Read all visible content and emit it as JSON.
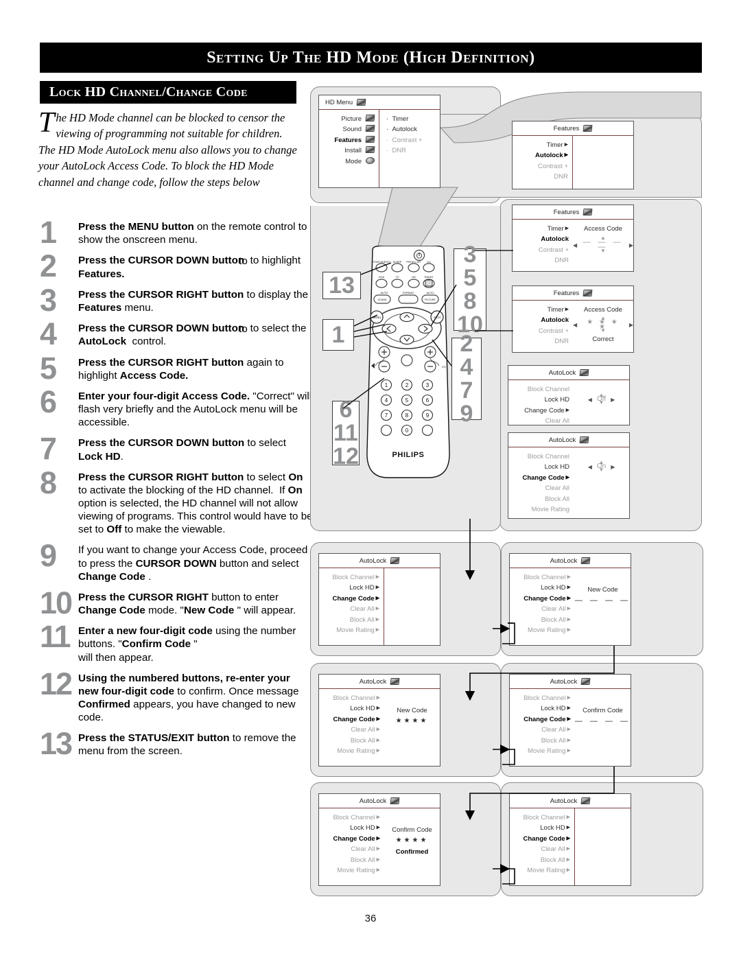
{
  "header": {
    "title": "Setting up the HD Mode (High Definition)",
    "section_title": "Lock HD Channel/Change Code"
  },
  "intro": {
    "dropcap": "T",
    "text": "he HD Mode channel can be blocked to censor the viewing of programming not suitable for children. The HD Mode AutoLock menu also allows you to change your AutoLock Access Code. To block the HD Mode channel and change code, follow the steps below"
  },
  "steps": [
    {
      "num": "1",
      "html": "<b>Press the MENU button</b> on the remote control to show the onscreen menu."
    },
    {
      "num": "2",
      "html": "<b>Press the CURSOR DOWN button</b><span class=\"ovl\"><span class=\"dup\">to</span></span>&nbsp;&nbsp;to highlight <b>Features.</b>"
    },
    {
      "num": "3",
      "html": "<b>Press the CURSOR RIGHT button</b> to display the <b>Features</b> menu."
    },
    {
      "num": "4",
      "html": "<b>Press the CURSOR DOWN button</b><span class=\"ovl\"><span class=\"dup\">to</span></span>&nbsp;&nbsp;to select the <b>AutoLock</b>&nbsp; control."
    },
    {
      "num": "5",
      "html": "<b>Press the CURSOR RIGHT button</b> again to highlight <b>Access Code.</b>"
    },
    {
      "num": "6",
      "html": "<b>Enter your four-digit Access Code.</b> \"Correct\" will flash very briefly and the AutoLock menu will be accessible."
    },
    {
      "num": "7",
      "html": "<b>Press the CURSOR DOWN button</b> to select <b>Lock HD</b>."
    },
    {
      "num": "8",
      "html": "<b>Press the CURSOR RIGHT button</b> to select <b>On</b> to activate the blocking of the HD channel.&nbsp; If <b>On</b> option is selected, the HD channel will not allow viewing of programs. This control would have to be set to <b>Off</b> to make the viewable."
    },
    {
      "num": "9",
      "html": "If you want to change your Access Code, proceed to press the <b>CURSOR DOWN</b> button and select <b>Change Code</b> ."
    },
    {
      "num": "10",
      "html": "<b>Press the CURSOR RIGHT</b> button to enter <b>Change Code</b> mode. \"<b>New Code</b> \" will appear."
    },
    {
      "num": "11",
      "html": "<b>Enter a new four-digit code</b> using the number buttons. \"<b>Confirm Code</b> \"<br>will then appear."
    },
    {
      "num": "12",
      "html": "<b>Using the numbered buttons, re-enter your new four-digit code</b> to confirm. Once message <b>Confirmed</b> appears, you have changed to new code."
    },
    {
      "num": "13",
      "html": "<b>Press the STATUS/EXIT button</b> to remove the menu from the screen."
    }
  ],
  "hd_menu": {
    "title": "HD Menu",
    "left_items": [
      {
        "label": "Picture",
        "state": "normal",
        "icon": "tv-picture-icon"
      },
      {
        "label": "Sound",
        "state": "normal",
        "icon": "speaker-icon"
      },
      {
        "label": "Features",
        "state": "bold",
        "icon": "features-icon"
      },
      {
        "label": "Install",
        "state": "normal",
        "icon": "install-icon"
      },
      {
        "label": "Mode",
        "state": "normal",
        "icon": "mode-icon"
      }
    ],
    "right_items": [
      {
        "label": "Timer",
        "state": "normal"
      },
      {
        "label": "Autolock",
        "state": "normal"
      },
      {
        "label": "Contrast +",
        "state": "dim"
      },
      {
        "label": "DNR",
        "state": "dim"
      }
    ]
  },
  "features_1": {
    "title": "Features",
    "items": [
      {
        "label": "Timer",
        "state": "normal",
        "arrow": true
      },
      {
        "label": "Autolock",
        "state": "bold",
        "arrow": true
      },
      {
        "label": "Contrast +",
        "state": "dim",
        "arrow": false
      },
      {
        "label": "DNR",
        "state": "dim",
        "arrow": false
      }
    ]
  },
  "features_2": {
    "title": "Features",
    "items": [
      {
        "label": "Timer",
        "state": "normal",
        "arrow": true
      },
      {
        "label": "Autolock",
        "state": "bold",
        "arrow": false
      },
      {
        "label": "Contrast +",
        "state": "dim",
        "arrow": false
      },
      {
        "label": "DNR",
        "state": "dim",
        "arrow": false
      }
    ],
    "right_label": "Access Code",
    "value": "— — — —",
    "status": ""
  },
  "features_3": {
    "title": "Features",
    "items": [
      {
        "label": "Timer",
        "state": "normal",
        "arrow": true
      },
      {
        "label": "Autolock",
        "state": "bold",
        "arrow": false
      },
      {
        "label": "Contrast +",
        "state": "dim",
        "arrow": false
      },
      {
        "label": "DNR",
        "state": "dim",
        "arrow": false
      }
    ],
    "right_label": "Access Code",
    "value": "★ ★ ★ ★",
    "status": "Correct"
  },
  "autolock_off": {
    "title": "AutoLock",
    "items": [
      {
        "label": "Block Channel",
        "state": "dim"
      },
      {
        "label": "Lock HD",
        "state": "normal"
      },
      {
        "label": "Change Code",
        "state": "normal",
        "arrow": true
      },
      {
        "label": "Clear All",
        "state": "dim"
      }
    ],
    "value": "Off"
  },
  "autolock_on": {
    "title": "AutoLock",
    "items": [
      {
        "label": "Block Channel",
        "state": "dim"
      },
      {
        "label": "Lock HD",
        "state": "normal"
      },
      {
        "label": "Change Code",
        "state": "bold",
        "arrow": true
      },
      {
        "label": "Clear All",
        "state": "dim"
      },
      {
        "label": "Block All",
        "state": "dim"
      },
      {
        "label": "Movie Rating",
        "state": "dim"
      }
    ],
    "value": "On"
  },
  "autolock_menu_a": {
    "title": "AutoLock",
    "items": [
      {
        "label": "Block Channel",
        "state": "dim",
        "arrow": true
      },
      {
        "label": "Lock HD",
        "state": "normal",
        "arrow": true
      },
      {
        "label": "Change Code",
        "state": "bold",
        "arrow": true
      },
      {
        "label": "Clear All",
        "state": "dim",
        "arrow": true
      },
      {
        "label": "Block All",
        "state": "dim",
        "arrow": true
      },
      {
        "label": "Movie Rating",
        "state": "dim",
        "arrow": true
      }
    ],
    "right_label": "",
    "value": "",
    "status": ""
  },
  "autolock_menu_b": {
    "title": "AutoLock",
    "items": [
      {
        "label": "Block Channel",
        "state": "dim",
        "arrow": true
      },
      {
        "label": "Lock HD",
        "state": "normal",
        "arrow": true
      },
      {
        "label": "Change Code",
        "state": "bold",
        "arrow": true
      },
      {
        "label": "Clear All",
        "state": "dim",
        "arrow": true
      },
      {
        "label": "Block All",
        "state": "dim",
        "arrow": true
      },
      {
        "label": "Movie Rating",
        "state": "dim",
        "arrow": true
      }
    ],
    "right_label": "New Code",
    "value": "—  —  —  —",
    "status": ""
  },
  "autolock_menu_c": {
    "title": "AutoLock",
    "items": [
      {
        "label": "Block Channel",
        "state": "dim",
        "arrow": true
      },
      {
        "label": "Lock HD",
        "state": "normal",
        "arrow": true
      },
      {
        "label": "Change Code",
        "state": "bold",
        "arrow": true
      },
      {
        "label": "Clear All",
        "state": "dim",
        "arrow": true
      },
      {
        "label": "Block All",
        "state": "dim",
        "arrow": true
      },
      {
        "label": "Movie Rating",
        "state": "dim",
        "arrow": true
      }
    ],
    "right_label": "New Code",
    "value": "★★★★",
    "status": ""
  },
  "autolock_menu_d": {
    "title": "AutoLock",
    "items": [
      {
        "label": "Block Channel",
        "state": "dim",
        "arrow": true
      },
      {
        "label": "Lock HD",
        "state": "normal",
        "arrow": true
      },
      {
        "label": "Change Code",
        "state": "bold",
        "arrow": true
      },
      {
        "label": "Clear All",
        "state": "dim",
        "arrow": true
      },
      {
        "label": "Block All",
        "state": "dim",
        "arrow": true
      },
      {
        "label": "Movie Rating",
        "state": "dim",
        "arrow": true
      }
    ],
    "right_label": "Confirm Code",
    "value": "—  —  —  —",
    "status": ""
  },
  "autolock_menu_e": {
    "title": "AutoLock",
    "items": [
      {
        "label": "Block Channel",
        "state": "dim",
        "arrow": true
      },
      {
        "label": "Lock HD",
        "state": "normal",
        "arrow": true
      },
      {
        "label": "Change Code",
        "state": "bold",
        "arrow": true
      },
      {
        "label": "Clear All",
        "state": "dim",
        "arrow": true
      },
      {
        "label": "Block All",
        "state": "dim",
        "arrow": true
      },
      {
        "label": "Movie Rating",
        "state": "dim",
        "arrow": true
      }
    ],
    "right_label": "Confirm Code",
    "value": "★★★★",
    "status": "Confirmed"
  },
  "autolock_menu_f": {
    "title": "AutoLock",
    "items": [
      {
        "label": "Block Channel",
        "state": "dim",
        "arrow": true
      },
      {
        "label": "Lock HD",
        "state": "normal",
        "arrow": true
      },
      {
        "label": "Change Code",
        "state": "bold",
        "arrow": true
      },
      {
        "label": "Clear All",
        "state": "dim",
        "arrow": true
      },
      {
        "label": "Block All",
        "state": "dim",
        "arrow": true
      },
      {
        "label": "Movie Rating",
        "state": "dim",
        "arrow": true
      }
    ],
    "right_label": "",
    "value": "",
    "status": ""
  },
  "remote": {
    "brand": "PHILIPS",
    "row1": [
      "STATUS/EXIT",
      "SLEEP",
      "PROG.LIST",
      "CC"
    ],
    "row2": [
      "VGA",
      "TV",
      "HD",
      "RADIO"
    ],
    "row3": [
      "AUTO SOUND",
      "FORMAT",
      "AUTO PICTURE"
    ],
    "menu_button": "MENU",
    "avm_button": "A/CH",
    "keypad": [
      "1",
      "2",
      "3",
      "4",
      "5",
      "6",
      "7",
      "8",
      "9",
      "",
      "0",
      ""
    ],
    "volume_label": "VOL",
    "channel_label": "CH"
  },
  "callouts": {
    "left_top": [
      "13"
    ],
    "left_mid": [
      "1"
    ],
    "left_bottom": [
      "6",
      "11",
      "12"
    ],
    "right_top": [
      "3",
      "5",
      "8",
      "10"
    ],
    "right_bottom": [
      "2",
      "4",
      "7",
      "9"
    ]
  },
  "footer": {
    "page_number": "36"
  },
  "colors": {
    "banner_bg": "#000000",
    "step_number": "#8f9193",
    "panel_bg": "#e8e8e8",
    "osd_divider": "#7a4040",
    "dim_text": "#9d9d9d"
  }
}
